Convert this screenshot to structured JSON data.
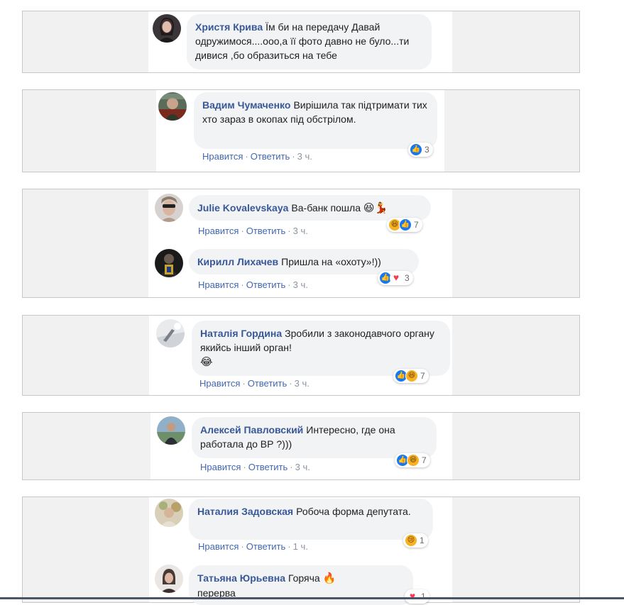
{
  "comments": [
    {
      "author": "Христя Крива",
      "text": "Їм би на передачу Давай одружимося....ооо,а її фото давно не було...ти дивися ,бо образиться на тебе"
    },
    {
      "author": "Вадим Чумаченко",
      "text": "Вирішила так підтримати тих хто зараз в окопах під обстрілом.",
      "like": "Нравится",
      "reply": "Ответить",
      "time": "3 ч.",
      "reactions": [
        "like"
      ],
      "reaction_count": "3"
    },
    {
      "author": "Julie Kovalevskaya",
      "text": "Ва-банк пошла",
      "emoji": "😆💃",
      "like": "Нравится",
      "reply": "Ответить",
      "time": "3 ч.",
      "reactions": [
        "haha",
        "like"
      ],
      "reaction_count": "7"
    },
    {
      "author": "Кирилл Лихачев",
      "text": "Пришла на «охоту»!))",
      "like": "Нравится",
      "reply": "Ответить",
      "time": "3 ч.",
      "reactions": [
        "like",
        "love"
      ],
      "reaction_count": "3"
    },
    {
      "author": "Наталія Гордина",
      "text": "Зробили з законодавчого органу якийсь інший орган!",
      "emoji": "😂",
      "like": "Нравится",
      "reply": "Ответить",
      "time": "3 ч.",
      "reactions": [
        "like",
        "haha"
      ],
      "reaction_count": "7"
    },
    {
      "author": "Алексей Павловский",
      "text": "Интересно, где она работала до ВР ?)))",
      "like": "Нравится",
      "reply": "Ответить",
      "time": "3 ч.",
      "reactions": [
        "like",
        "haha"
      ],
      "reaction_count": "7"
    },
    {
      "author": "Наталия Задовская",
      "text": "Робоча форма депутата.",
      "like": "Нравится",
      "reply": "Ответить",
      "time": "1 ч.",
      "reactions": [
        "sad"
      ],
      "reaction_count": "1"
    },
    {
      "author": "Татьяна Юрьевна",
      "text": "Горяча",
      "emoji": "🔥",
      "text2": "перерва",
      "reactions": [
        "love"
      ],
      "reaction_count": "1"
    }
  ],
  "colors": {
    "author": "#385898",
    "link": "#4267b2",
    "bubble": "#f2f3f5",
    "card": "#f1f1f1",
    "like": "#1877f2",
    "love": "#f33e58",
    "haha": "#f7b125"
  }
}
